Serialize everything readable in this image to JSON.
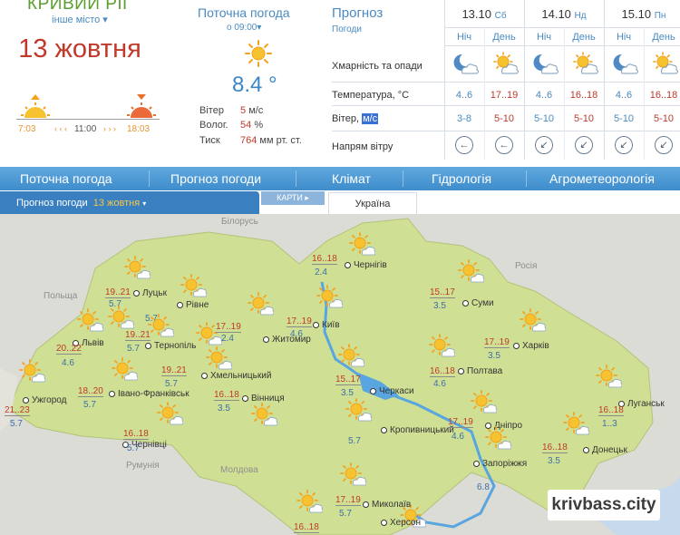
{
  "city": {
    "name": "КРИВИЙ РІГ",
    "other_city": "інше місто",
    "date": "13 жовтня"
  },
  "sun": {
    "sunrise": "7:03",
    "noon": "11:00",
    "sunset": "18:03"
  },
  "current": {
    "title": "Поточна погода",
    "at": "о 09:00",
    "temp": "8.4 °",
    "wind_label": "Вітер",
    "wind_value": "5",
    "wind_unit": "м/с",
    "hum_label": "Волог.",
    "hum_value": "54",
    "hum_unit": "%",
    "pres_label": "Тиск",
    "pres_value": "764",
    "pres_unit": "мм рт. ст."
  },
  "forecast": {
    "title": "Прогноз",
    "subtitle": "Погоди",
    "rows": {
      "cloud": "Хмарність та опади",
      "temp": "Температура, °C",
      "wind": "Вітер,",
      "wind_unit": "м/с",
      "dir": "Напрям вітру"
    },
    "days": [
      {
        "date": "13.10",
        "dow": "Сб"
      },
      {
        "date": "14.10",
        "dow": "Нд"
      },
      {
        "date": "15.10",
        "dow": "Пн"
      }
    ],
    "periods": [
      "Ніч",
      "День",
      "Ніч",
      "День",
      "Ніч",
      "День"
    ],
    "temps": [
      "4..6",
      "17..19",
      "4..6",
      "16..18",
      "4..6",
      "16..18"
    ],
    "winds": [
      "3-8",
      "5-10",
      "5-10",
      "5-10",
      "5-10",
      "5-10"
    ],
    "dirs": [
      "←",
      "←",
      "↙",
      "↙",
      "↙",
      "↙"
    ],
    "cloud_icons": [
      "moon-cloud-icon",
      "sun-cloud-icon",
      "moon-cloud-icon",
      "sun-cloud-icon",
      "moon-cloud-icon",
      "sun-cloud-icon"
    ]
  },
  "nav": [
    "Поточна погода",
    "Прогноз погоди",
    "Клімат",
    "Гідрологія",
    "Агрометеорологія"
  ],
  "subbar": {
    "label": "Прогноз погоди",
    "date": "13 жовтня",
    "maps": "КАРТИ",
    "region": "Україна"
  },
  "map": {
    "countries": [
      "Білорусь",
      "Росія",
      "Польща",
      "Румунія",
      "Молдова"
    ],
    "cities": [
      {
        "name": "Луцьк",
        "temp": "19..21",
        "wind": "5.7"
      },
      {
        "name": "Рівне",
        "temp": "",
        "wind": "5.7"
      },
      {
        "name": "Львів",
        "temp": "20..22",
        "wind": "4.6"
      },
      {
        "name": "Тернопіль",
        "temp": "19..21",
        "wind": "5.7"
      },
      {
        "name": "Житомир",
        "temp": "17..19",
        "wind": "2.4"
      },
      {
        "name": "Київ",
        "temp": "17..19",
        "wind": "4.6"
      },
      {
        "name": "Чернігів",
        "temp": "16..18",
        "wind": "2.4"
      },
      {
        "name": "Суми",
        "temp": "15..17",
        "wind": "3.5"
      },
      {
        "name": "Харків",
        "temp": "17..19",
        "wind": "3.5"
      },
      {
        "name": "Полтава",
        "temp": "16..18",
        "wind": "4.6"
      },
      {
        "name": "Ужгород",
        "temp": "21..23",
        "wind": "5.7"
      },
      {
        "name": "Івано-Франківськ",
        "temp": "18..20",
        "wind": "5.7"
      },
      {
        "name": "Хмельницький",
        "temp": "19..21",
        "wind": "5.7"
      },
      {
        "name": "Вінниця",
        "temp": "16..18",
        "wind": "3.5"
      },
      {
        "name": "Черкаси",
        "temp": "15..17",
        "wind": "3.5"
      },
      {
        "name": "Кропивницький",
        "temp": "",
        "wind": "5.7"
      },
      {
        "name": "Дніпро",
        "temp": "17..19",
        "wind": "4.6"
      },
      {
        "name": "Луганськ",
        "temp": "16..18",
        "wind": "1..3"
      },
      {
        "name": "Донецьк",
        "temp": "16..18",
        "wind": "3.5"
      },
      {
        "name": "Запоріжжя",
        "temp": "",
        "wind": "6.8"
      },
      {
        "name": "Чернівці",
        "temp": "16..18",
        "wind": "5.7"
      },
      {
        "name": "Миколаїв",
        "temp": "17..19",
        "wind": "5.7"
      },
      {
        "name": "Херсон",
        "temp": "16..18",
        "wind": ""
      }
    ],
    "watermark": "krivbass.city"
  },
  "colors": {
    "accent": "#3f8ccc",
    "brand_green": "#5a9e2e",
    "temp_red": "#c0392b",
    "sun": "#f4a21c",
    "map_land": "#cfe095"
  }
}
